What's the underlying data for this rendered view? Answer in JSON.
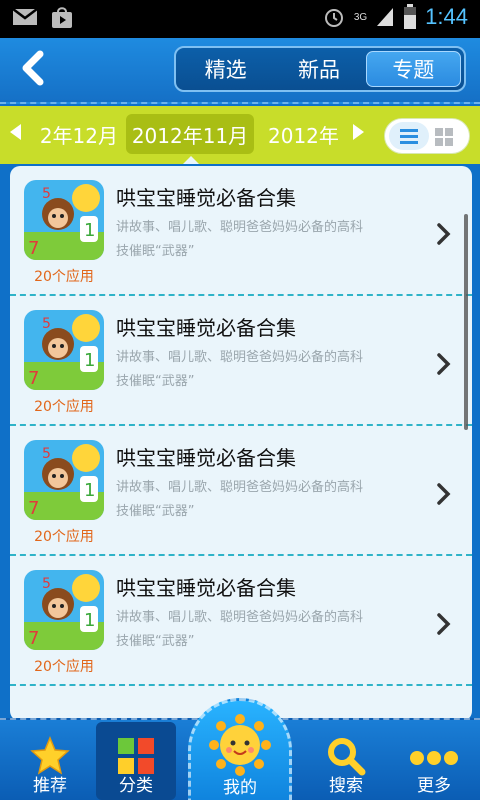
{
  "status": {
    "time": "1:44",
    "network": "3G"
  },
  "header": {
    "tabs": [
      {
        "label": "精选",
        "active": false
      },
      {
        "label": "新品",
        "active": false
      },
      {
        "label": "专题",
        "active": true
      }
    ]
  },
  "months": {
    "prev": "2年12月",
    "current": "2012年11月",
    "next": "2012年"
  },
  "items": [
    {
      "title": "哄宝宝睡觉必备合集",
      "desc_line1": "讲故事、唱儿歌、聪明爸爸妈妈必备的高科",
      "desc_line2": "技催眠“武器”",
      "count": "20个应用"
    },
    {
      "title": "哄宝宝睡觉必备合集",
      "desc_line1": "讲故事、唱儿歌、聪明爸爸妈妈必备的高科",
      "desc_line2": "技催眠“武器”",
      "count": "20个应用"
    },
    {
      "title": "哄宝宝睡觉必备合集",
      "desc_line1": "讲故事、唱儿歌、聪明爸爸妈妈必备的高科",
      "desc_line2": "技催眠“武器”",
      "count": "20个应用"
    },
    {
      "title": "哄宝宝睡觉必备合集",
      "desc_line1": "讲故事、唱儿歌、聪明爸爸妈妈必备的高科",
      "desc_line2": "技催眠“武器”",
      "count": "20个应用"
    }
  ],
  "bottom_nav": [
    {
      "label": "推荐",
      "icon": "star-icon"
    },
    {
      "label": "分类",
      "icon": "category-icon",
      "active": true
    },
    {
      "label": "我的",
      "icon": "sun-icon"
    },
    {
      "label": "搜索",
      "icon": "search-icon"
    },
    {
      "label": "更多",
      "icon": "more-icon"
    }
  ],
  "colors": {
    "accent_blue": "#1570c6",
    "lime": "#c8dd2a",
    "count_orange": "#e2671b"
  }
}
